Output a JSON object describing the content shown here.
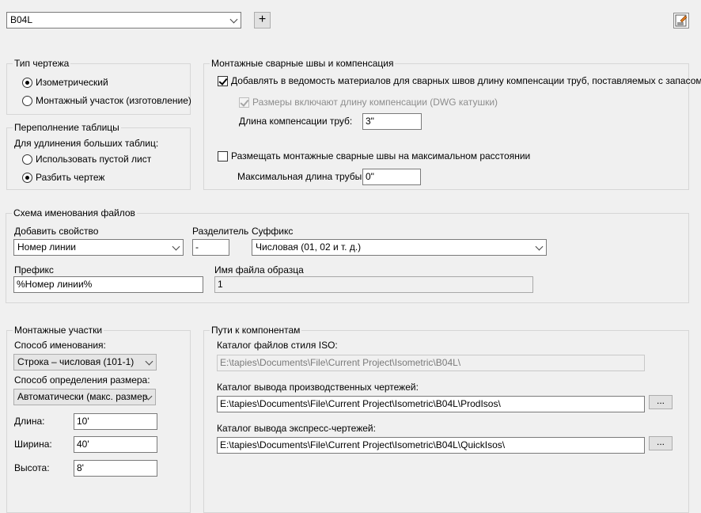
{
  "top": {
    "style_select": "B04L",
    "add_button_label": "+",
    "edit_icon": "edit-style-icon"
  },
  "drawing_type": {
    "title": "Тип чертежа",
    "options": [
      "Изометрический",
      "Монтажный участок (изготовление)"
    ],
    "selected": 0
  },
  "table_overflow": {
    "title": "Переполнение таблицы",
    "prompt": "Для удлинения больших таблиц:",
    "options": [
      "Использовать пустой лист",
      "Разбить чертеж"
    ],
    "selected": 1
  },
  "field_welds": {
    "title": "Монтажные сварные швы и компенсация",
    "add_to_bom_label": "Добавлять в ведомость материалов для сварных швов длину компенсации труб, поставляемых с запасом",
    "add_to_bom_checked": true,
    "include_length_label": "Размеры включают длину компенсации (DWG катушки)",
    "include_length_checked": true,
    "compensation_label": "Длина компенсации труб:",
    "compensation_value": "3\"",
    "max_distance_label": "Размещать монтажные сварные швы на максимальном расстоянии",
    "max_distance_checked": false,
    "max_pipe_label": "Максимальная длина трубы:",
    "max_pipe_value": "0\""
  },
  "file_naming": {
    "title": "Схема именования файлов",
    "add_property_label": "Добавить свойство",
    "add_property_value": "Номер линии",
    "separator_label": "Разделитель",
    "separator_value": "-",
    "suffix_label": "Суффикс",
    "suffix_value": "Числовая (01, 02 и т. д.)",
    "prefix_label": "Префикс",
    "prefix_value": "%Номер линии%",
    "sample_label": "Имя файла образца",
    "sample_value": "1"
  },
  "spools": {
    "title": "Монтажные участки",
    "naming_label": "Способ именования:",
    "naming_value": "Строка – числовая (101-1)",
    "size_label": "Способ определения размера:",
    "size_value": "Автоматически (макс. размер",
    "length_label": "Длина:",
    "length_value": "10'",
    "width_label": "Ширина:",
    "width_value": "40'",
    "height_label": "Высота:",
    "height_value": "8'"
  },
  "paths": {
    "title": "Пути к компонентам",
    "iso_style_label": "Каталог файлов стиля ISO:",
    "iso_style_value": "E:\\tapies\\Documents\\File\\Current Project\\Isometric\\B04L\\",
    "prod_label": "Каталог вывода производственных чертежей:",
    "prod_value": "E:\\tapies\\Documents\\File\\Current Project\\Isometric\\B04L\\ProdIsos\\",
    "quick_label": "Каталог вывода экспресс-чертежей:",
    "quick_value": "E:\\tapies\\Documents\\File\\Current Project\\Isometric\\B04L\\QuickIsos\\",
    "browse_label": "..."
  }
}
